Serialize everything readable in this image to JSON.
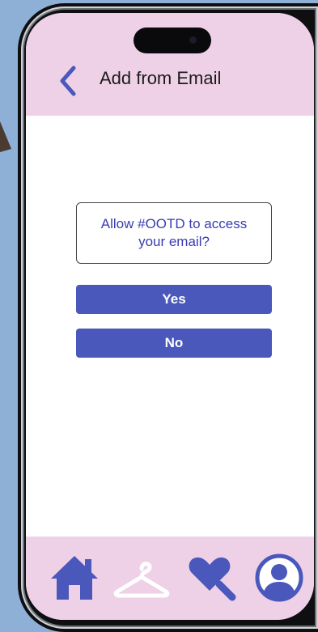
{
  "header": {
    "title": "Add from Email",
    "back_icon": "chevron-left-icon"
  },
  "dialog": {
    "message": "Allow #OOTD to access your email?",
    "yes_label": "Yes",
    "no_label": "No"
  },
  "bottom_nav": {
    "items": [
      {
        "icon": "home-icon"
      },
      {
        "icon": "hanger-icon"
      },
      {
        "icon": "heart-search-icon"
      },
      {
        "icon": "profile-icon"
      }
    ]
  },
  "colors": {
    "background": "#8fb0d6",
    "header_bg": "#efd1e7",
    "accent": "#4a57bb",
    "prompt_text": "#3a3db0"
  }
}
